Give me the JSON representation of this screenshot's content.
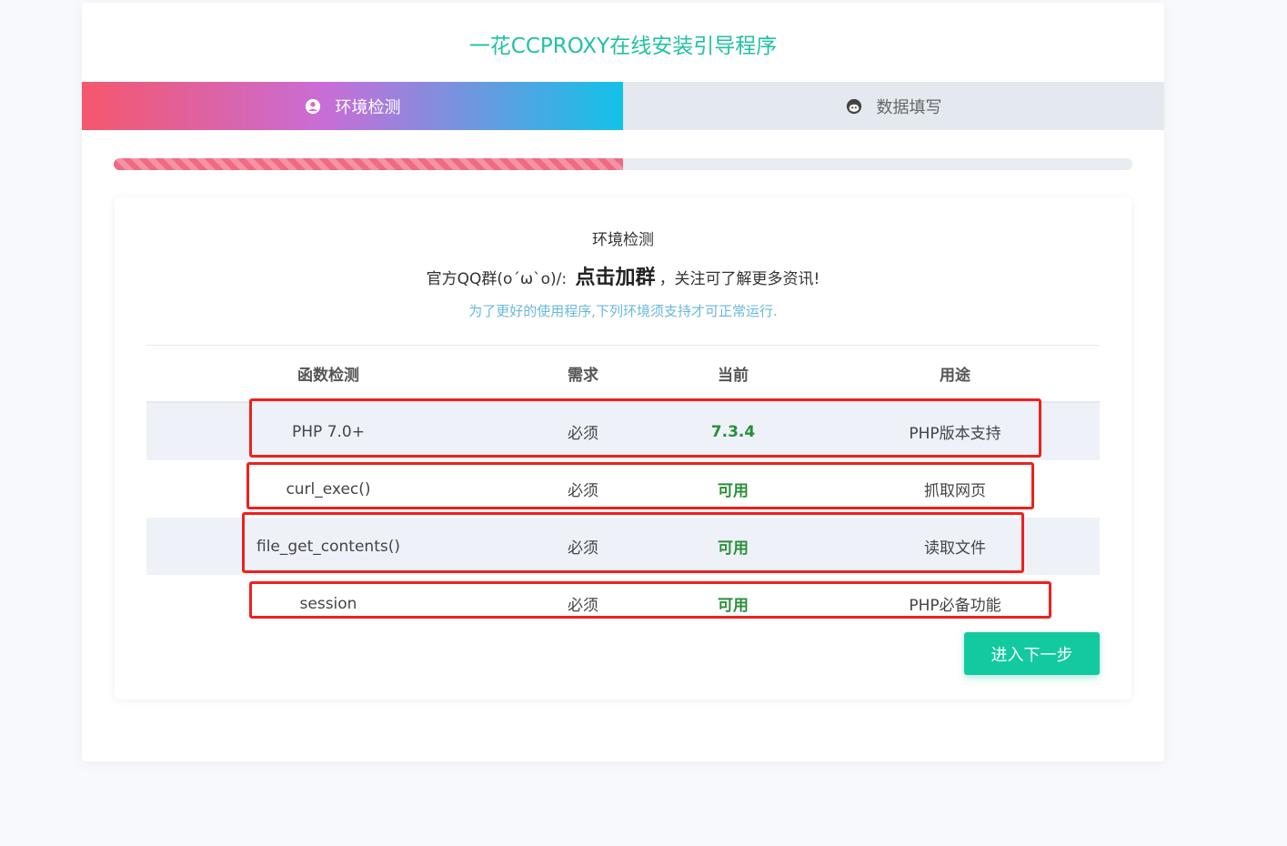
{
  "header": {
    "title": "一花CCPROXY在线安装引导程序"
  },
  "steps": [
    {
      "label": "环境检测",
      "icon": "user-circle-icon",
      "active": true
    },
    {
      "label": "数据填写",
      "icon": "face-icon",
      "active": false
    }
  ],
  "progress": {
    "percent": 50,
    "color": "#f06a83"
  },
  "panel": {
    "title": "环境检测",
    "qq_prefix": "官方QQ群(o´ω`o)/:",
    "qq_link": "点击加群",
    "qq_suffix": "，关注可了解更多资讯!",
    "hint": "为了更好的使用程序,下列环境须支持才可正常运行."
  },
  "table": {
    "headers": [
      "函数检测",
      "需求",
      "当前",
      "用途"
    ],
    "rows": [
      [
        "PHP 7.0+",
        "必须",
        "7.3.4",
        "PHP版本支持"
      ],
      [
        "curl_exec()",
        "必须",
        "可用",
        "抓取网页"
      ],
      [
        "file_get_contents()",
        "必须",
        "可用",
        "读取文件"
      ],
      [
        "session",
        "必须",
        "可用",
        "PHP必备功能"
      ]
    ]
  },
  "next_button": {
    "label": "进入下一步"
  },
  "colors": {
    "accent": "#21c1a5",
    "button": "#13c9a0",
    "ok": "#2a8f3a",
    "highlight": "#f0201c"
  }
}
